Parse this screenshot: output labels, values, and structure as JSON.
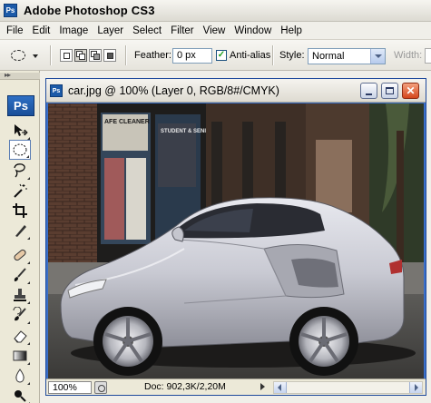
{
  "app": {
    "title": "Adobe Photoshop CS3",
    "logo": "Ps"
  },
  "menu": [
    "File",
    "Edit",
    "Image",
    "Layer",
    "Select",
    "Filter",
    "View",
    "Window",
    "Help"
  ],
  "options": {
    "feather_label": "Feather:",
    "feather_value": "0 px",
    "antialias_label": "Anti-alias",
    "antialias_checked": true,
    "style_label": "Style:",
    "style_value": "Normal",
    "width_label": "Width:"
  },
  "toolbox": {
    "logo": "Ps",
    "tools": [
      {
        "name": "move-tool",
        "icon": "move-icon"
      },
      {
        "name": "elliptical-marquee-tool",
        "icon": "ellipse-marquee-icon",
        "active": true
      },
      {
        "name": "lasso-tool",
        "icon": "lasso-icon"
      },
      {
        "name": "magic-wand-tool",
        "icon": "magic-wand-icon"
      },
      {
        "name": "crop-tool",
        "icon": "crop-icon"
      },
      {
        "name": "slice-tool",
        "icon": "slice-icon"
      },
      {
        "name": "healing-brush-tool",
        "icon": "bandage-icon"
      },
      {
        "name": "brush-tool",
        "icon": "brush-icon"
      },
      {
        "name": "clone-stamp-tool",
        "icon": "stamp-icon"
      },
      {
        "name": "history-brush-tool",
        "icon": "history-brush-icon"
      },
      {
        "name": "eraser-tool",
        "icon": "eraser-icon"
      },
      {
        "name": "gradient-tool",
        "icon": "gradient-icon"
      },
      {
        "name": "blur-tool",
        "icon": "drop-icon"
      },
      {
        "name": "dodge-tool",
        "icon": "dodge-icon"
      }
    ]
  },
  "document": {
    "title": "car.jpg @ 100% (Layer 0, RGB/8#/CMYK)",
    "zoom": "100%",
    "doc_info": "Doc: 902,3K/2,20M",
    "store_sign_1": "AFE CLEANER",
    "store_sign_2": "STUDENT & SENIOR DISCOUNT"
  }
}
